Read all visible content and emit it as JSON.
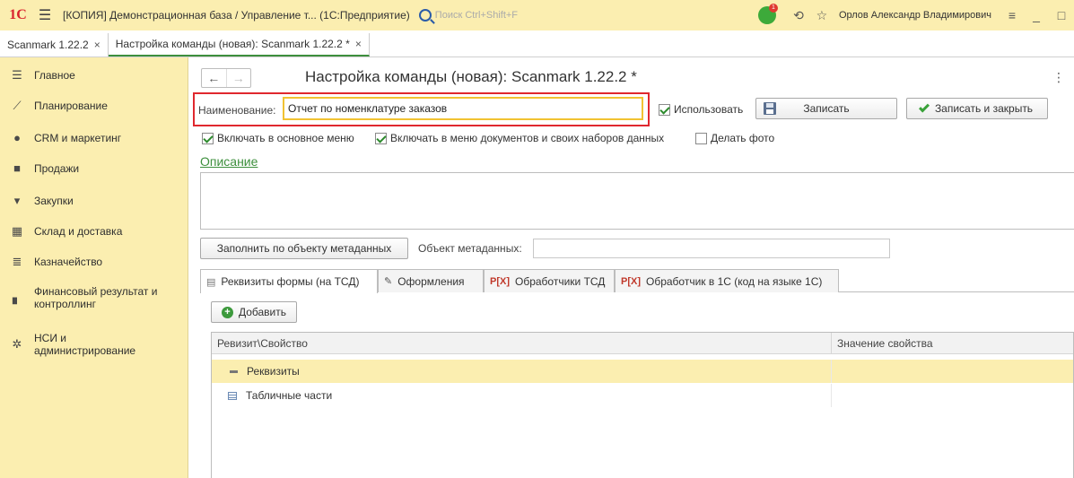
{
  "window": {
    "logo": "1С",
    "title": "[КОПИЯ] Демонстрационная база / Управление т...  (1С:Предприятие)",
    "search_placeholder": "Поиск Ctrl+Shift+F",
    "notification_count": "1",
    "user": "Орлов Александр Владимирович"
  },
  "doc_tabs": [
    {
      "label": "Scanmark 1.22.2",
      "close": "×"
    },
    {
      "label": "Настройка команды (новая): Scanmark 1.22.2 *",
      "close": "×"
    }
  ],
  "sidebar": {
    "items": [
      {
        "label": "Главное",
        "icon": "menu-icon"
      },
      {
        "label": "Планирование",
        "icon": "planning-icon"
      },
      {
        "label": "CRM и маркетинг",
        "icon": "crm-icon"
      },
      {
        "label": "Продажи",
        "icon": "bag-icon"
      },
      {
        "label": "Закупки",
        "icon": "cart-icon"
      },
      {
        "label": "Склад и доставка",
        "icon": "warehouse-icon"
      },
      {
        "label": "Казначейство",
        "icon": "treasury-icon"
      },
      {
        "label": "Финансовый результат и контроллинг",
        "icon": "chart-icon"
      },
      {
        "label": "НСИ и администрирование",
        "icon": "gear-icon"
      }
    ]
  },
  "form": {
    "title": "Настройка команды (новая): Scanmark 1.22.2 *",
    "name_label": "Наименование:",
    "name_value": "Отчет по номенклатуре заказов",
    "use_label": "Использовать",
    "save_label": "Записать",
    "save_close_label": "Записать и закрыть",
    "include_main_menu": "Включать в основное меню",
    "include_doc_menu": "Включать в меню документов и своих наборов данных",
    "take_photo": "Делать фото",
    "description_link": "Описание",
    "fill_button": "Заполнить по объекту метаданных",
    "metadata_label": "Объект метаданных:",
    "metadata_value": ""
  },
  "panel_tabs": [
    {
      "label": "Реквизиты формы (на ТСД)",
      "icon": "form-icon"
    },
    {
      "label": "Оформления",
      "icon": "brush-icon"
    },
    {
      "label": "Обработчики ТСД",
      "icon": "handler-icon"
    },
    {
      "label": "Обработчик в 1С  (код на языке 1С)",
      "icon": "handler-icon"
    }
  ],
  "table": {
    "add_button": "Добавить",
    "columns": [
      "Ревизит\\Свойство",
      "Значение свойства"
    ],
    "rows": [
      {
        "label": "Реквизиты",
        "value": ""
      },
      {
        "label": "Табличные части",
        "value": ""
      }
    ]
  },
  "colors": {
    "panel_yellow": "#fbeeb0",
    "accent_green": "#3d8f3d",
    "highlight_red": "#e0282e",
    "input_focus": "#f1c232"
  }
}
